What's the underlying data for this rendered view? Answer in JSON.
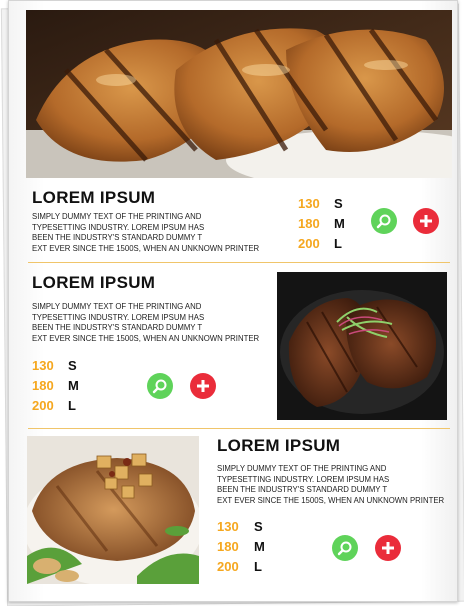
{
  "menu": {
    "items": [
      {
        "title": "LOREM IPSUM",
        "desc_lines": [
          "SIMPLY DUMMY TEXT OF THE PRINTING AND",
          "TYPESETTING INDUSTRY. LOREM IPSUM HAS",
          "BEEN THE INDUSTRY'S STANDARD DUMMY T",
          "EXT EVER SINCE THE 1500S, WHEN AN UNKNOWN PRINTER"
        ],
        "prices": [
          "130",
          "180",
          "200"
        ],
        "sizes": [
          "S",
          "M",
          "L"
        ]
      },
      {
        "title": "LOREM IPSUM",
        "desc_lines": [
          "SIMPLY DUMMY TEXT OF THE PRINTING AND",
          "TYPESETTING INDUSTRY. LOREM IPSUM HAS",
          "BEEN THE INDUSTRY'S STANDARD DUMMY T",
          "EXT EVER SINCE THE 1500S, WHEN AN UNKNOWN PRINTER"
        ],
        "prices": [
          "130",
          "180",
          "200"
        ],
        "sizes": [
          "S",
          "M",
          "L"
        ]
      },
      {
        "title": "LOREM IPSUM",
        "desc_lines": [
          "SIMPLY DUMMY TEXT OF THE PRINTING AND",
          "TYPESETTING INDUSTRY. LOREM IPSUM HAS",
          "BEEN THE INDUSTRY'S STANDARD DUMMY T",
          "EXT EVER SINCE THE 1500S, WHEN AN UNKNOWN PRINTER"
        ],
        "prices": [
          "130",
          "180",
          "200"
        ],
        "sizes": [
          "S",
          "M",
          "L"
        ]
      }
    ]
  },
  "icons": {
    "zoom": "magnifier-icon",
    "add": "plus-icon"
  },
  "colors": {
    "price": "#f5a71f",
    "zoom_button": "#5fd35a",
    "add_button": "#ea2c3a",
    "divider": "#f0c56a"
  }
}
